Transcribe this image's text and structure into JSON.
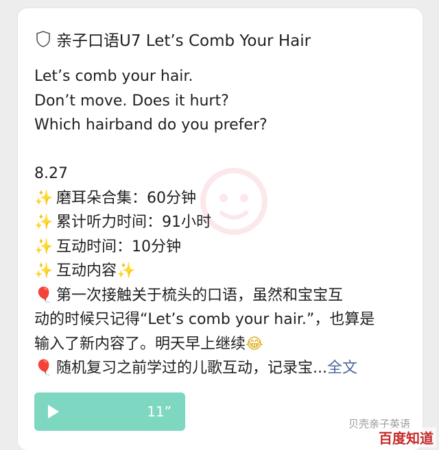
{
  "post": {
    "title": "亲子口语U7 Let’s Comb Your Hair",
    "phrases": [
      "Let’s comb your hair.",
      "Don’t move. Does it hurt?",
      "Which hairband do you prefer?"
    ],
    "date": "8.27",
    "stats": [
      "磨耳朵合集：60分钟",
      "累计听力时间：91小时",
      "互动时间：10分钟",
      "互动内容"
    ],
    "paragraph1_lines": [
      "第一次接触关于梳头的口语，虽然和宝宝互",
      "动的时候只记得“Let’s comb your hair.”，也算是",
      "输入了新内容了。明天早上继续"
    ],
    "paragraph2_line": "随机复习之前学过的儿歌互动，记录宝...",
    "more_link": "全文"
  },
  "audio": {
    "duration": "11”"
  },
  "watermarks": {
    "account": "贝壳亲子英语",
    "baidu": "百度知道"
  },
  "icons": {
    "title": "shield-icon",
    "sparkle": "sparkles-emoji",
    "balloon": "balloon-emoji",
    "laugh": "laughing-emoji"
  },
  "colors": {
    "audio_bar": "#7ed7c1",
    "link": "#4a6b9a",
    "baidu": "#c52b2b"
  }
}
